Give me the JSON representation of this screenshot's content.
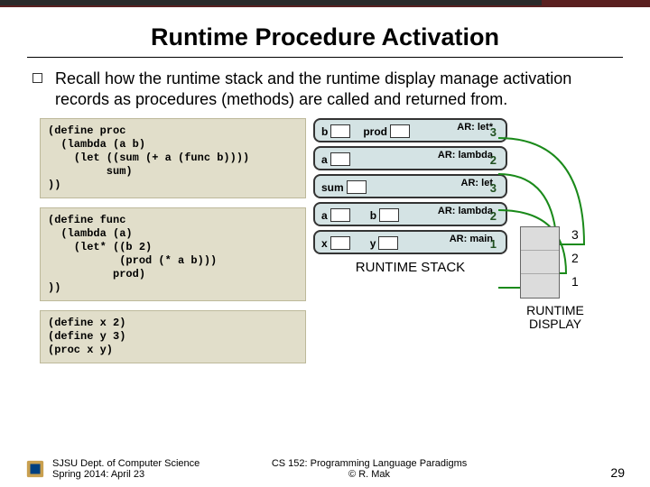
{
  "title": "Runtime Procedure Activation",
  "bullet": "Recall how the runtime stack and the runtime display manage activation records as procedures (methods) are called and returned from.",
  "code": {
    "block1": "(define proc\n  (lambda (a b)\n    (let ((sum (+ a (func b))))\n         sum)\n))",
    "block2": "(define func\n  (lambda (a)\n    (let* ((b 2)\n           (prod (* a b)))\n          prod)\n))",
    "block3": "(define x 2)\n(define y 3)\n(proc x y)"
  },
  "stack": {
    "frames": [
      {
        "vars": [
          "b",
          "prod"
        ],
        "ar": "AR: let*",
        "num": "3"
      },
      {
        "vars": [
          "a"
        ],
        "ar": "AR: lambda",
        "num": "2"
      },
      {
        "vars": [
          "sum"
        ],
        "ar": "AR: let",
        "num": "3"
      },
      {
        "vars": [
          "a",
          "b"
        ],
        "ar": "AR: lambda",
        "num": "2"
      },
      {
        "vars": [
          "x",
          "y"
        ],
        "ar": "AR: main",
        "num": "1"
      }
    ],
    "label": "RUNTIME STACK"
  },
  "display": {
    "indices": [
      "3",
      "2",
      "1"
    ],
    "label": "RUNTIME\nDISPLAY"
  },
  "footer": {
    "dept": "SJSU Dept. of Computer Science\nSpring 2014: April 23",
    "course": "CS 152: Programming Language Paradigms\n© R. Mak",
    "slide": "29"
  }
}
